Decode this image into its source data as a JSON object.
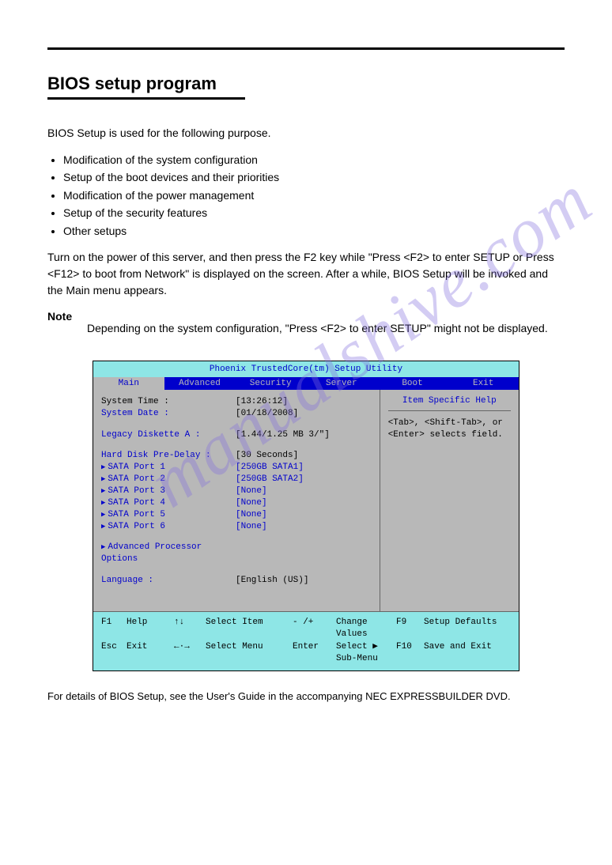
{
  "page": {
    "section_title": "BIOS setup program",
    "p1": "BIOS Setup is used for the following purpose.",
    "bullets": [
      "Modification of the system configuration",
      "Setup of the boot devices and their priorities",
      "Modification of the power management",
      "Setup of the security features",
      "Other setups"
    ],
    "p2": "Turn on the power of this server, and then press the F2 key while \"Press <F2> to enter SETUP or Press <F12> to boot from Network\" is displayed on the screen. After a while, BIOS Setup will be invoked and the Main menu appears.",
    "note_label": "Note",
    "note_text": "Depending on the system configuration, \"Press <F2> to enter SETUP\" might not be displayed.",
    "footer_text": "For details of BIOS Setup, see the User's Guide in the accompanying NEC EXPRESSBUILDER DVD."
  },
  "bios": {
    "title": "Phoenix TrustedCore(tm) Setup Utility",
    "tabs": [
      "Main",
      "Advanced",
      "Security",
      "Server",
      "Boot",
      "Exit"
    ],
    "active_tab": 0,
    "help_title": "Item Specific Help",
    "help_text": "<Tab>, <Shift-Tab>, or <Enter> selects field.",
    "rows": [
      {
        "label": "System Time :",
        "value": "[13:26:12]",
        "label_class": "black-t",
        "value_class": "black-t",
        "tri": false,
        "blank_after": false
      },
      {
        "label": "System Date :",
        "value": "[01/18/2008]",
        "label_class": "blue-t",
        "value_class": "black-t",
        "tri": false,
        "blank_after": true
      },
      {
        "label": "Legacy Diskette A :",
        "value": "[1.44/1.25 MB  3/\"]",
        "label_class": "blue-t",
        "value_class": "black-t",
        "tri": false,
        "blank_after": true
      },
      {
        "label": "Hard Disk Pre-Delay :",
        "value": "[30 Seconds]",
        "label_class": "blue-t",
        "value_class": "black-t",
        "tri": false,
        "blank_after": false
      },
      {
        "label": "SATA Port 1",
        "value": "[250GB SATA1]",
        "label_class": "blue-t",
        "value_class": "blue-t",
        "tri": true,
        "blank_after": false
      },
      {
        "label": "SATA Port 2",
        "value": "[250GB SATA2]",
        "label_class": "blue-t",
        "value_class": "blue-t",
        "tri": true,
        "blank_after": false
      },
      {
        "label": "SATA Port 3",
        "value": "[None]",
        "label_class": "blue-t",
        "value_class": "blue-t",
        "tri": true,
        "blank_after": false
      },
      {
        "label": "SATA Port 4",
        "value": "[None]",
        "label_class": "blue-t",
        "value_class": "blue-t",
        "tri": true,
        "blank_after": false
      },
      {
        "label": "SATA Port 5",
        "value": "[None]",
        "label_class": "blue-t",
        "value_class": "blue-t",
        "tri": true,
        "blank_after": false
      },
      {
        "label": "SATA Port 6",
        "value": "[None]",
        "label_class": "blue-t",
        "value_class": "blue-t",
        "tri": true,
        "blank_after": true
      },
      {
        "label": "Advanced Processor Options",
        "value": "",
        "label_class": "blue-t",
        "value_class": "",
        "tri": true,
        "blank_after": true
      },
      {
        "label": "Language :",
        "value": "[English (US)]",
        "label_class": "blue-t",
        "value_class": "black-t",
        "tri": false,
        "blank_after": false
      }
    ],
    "footer": {
      "r1": {
        "k1": "F1",
        "n1": "Help",
        "ar": "↑↓",
        "ad": "Select Item",
        "ck": "- /+",
        "cd": "Change Values",
        "rk": "F9",
        "rd": "Setup Defaults"
      },
      "r2": {
        "k1": "Esc",
        "n1": "Exit",
        "ar": "←·→",
        "ad": "Select Menu",
        "ck": "Enter",
        "cd": "Select ▶ Sub-Menu",
        "rk": "F10",
        "rd": "Save and Exit"
      }
    }
  },
  "watermark": "manualshive.com"
}
